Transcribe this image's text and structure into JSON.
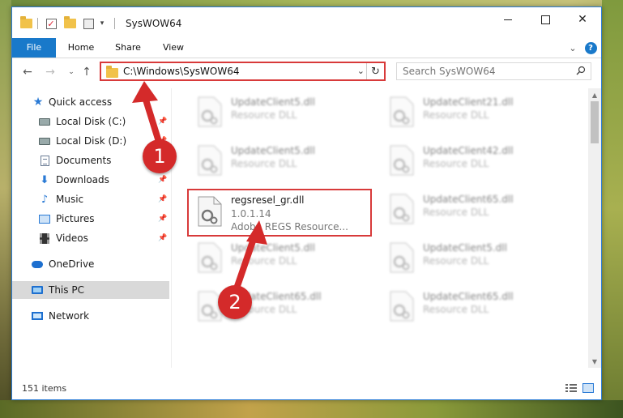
{
  "window": {
    "title": "SysWOW64",
    "accent": "#1979ca",
    "close_glyph": "✕"
  },
  "ribbon": {
    "tabs": [
      "File",
      "Home",
      "Share",
      "View"
    ],
    "help_glyph": "?",
    "expand_glyph": "⌄"
  },
  "address_bar": {
    "path": "C:\\Windows\\SysWOW64",
    "dropdown_glyph": "⌄",
    "refresh_glyph": "↻"
  },
  "nav": {
    "back_glyph": "←",
    "forward_glyph": "→",
    "recent_glyph": "⌄",
    "up_glyph": "↑"
  },
  "search": {
    "placeholder": "Search SysWOW64"
  },
  "sidebar": {
    "items": [
      {
        "label": "Quick access",
        "icon": "star-icon",
        "pinned": false
      },
      {
        "label": "Local Disk (C:)",
        "icon": "disk-icon",
        "pinned": true
      },
      {
        "label": "Local Disk (D:)",
        "icon": "disk-icon",
        "pinned": true
      },
      {
        "label": "Documents",
        "icon": "documents-icon",
        "pinned": true
      },
      {
        "label": "Downloads",
        "icon": "downloads-icon",
        "pinned": true
      },
      {
        "label": "Music",
        "icon": "music-icon",
        "pinned": true
      },
      {
        "label": "Pictures",
        "icon": "pictures-icon",
        "pinned": true
      },
      {
        "label": "Videos",
        "icon": "videos-icon",
        "pinned": true
      },
      {
        "label": "OneDrive",
        "icon": "onedrive-icon",
        "pinned": false
      },
      {
        "label": "This PC",
        "icon": "this-pc-icon",
        "pinned": false,
        "selected": true
      },
      {
        "label": "Network",
        "icon": "network-icon",
        "pinned": false
      }
    ]
  },
  "files": [
    {
      "name": "UpdateClient5.dll",
      "line2": "Resource DLL",
      "blurred": true
    },
    {
      "name": "UpdateClient21.dll",
      "line2": "Resource DLL",
      "blurred": true
    },
    {
      "name": "UpdateClient5.dll",
      "line2": "Resource DLL",
      "blurred": true
    },
    {
      "name": "UpdateClient42.dll",
      "line2": "Resource DLL",
      "blurred": true
    },
    {
      "name": "regsresel_gr.dll",
      "line2": "1.0.1.14",
      "line3": "Adobe REGS Resource...",
      "blurred": false,
      "highlighted": true
    },
    {
      "name": "UpdateClient65.dll",
      "line2": "Resource DLL",
      "blurred": true
    },
    {
      "name": "UpdateClient5.dll",
      "line2": "Resource DLL",
      "blurred": true
    },
    {
      "name": "UpdateClient5.dll",
      "line2": "Resource DLL",
      "blurred": true
    },
    {
      "name": "UpdateClient65.dll",
      "line2": "Resource DLL",
      "blurred": true
    },
    {
      "name": "UpdateClient65.dll",
      "line2": "Resource DLL",
      "blurred": true
    }
  ],
  "status": {
    "item_count": "151 items"
  },
  "annotations": {
    "step1": "1",
    "step2": "2",
    "color": "#d42a2a"
  }
}
